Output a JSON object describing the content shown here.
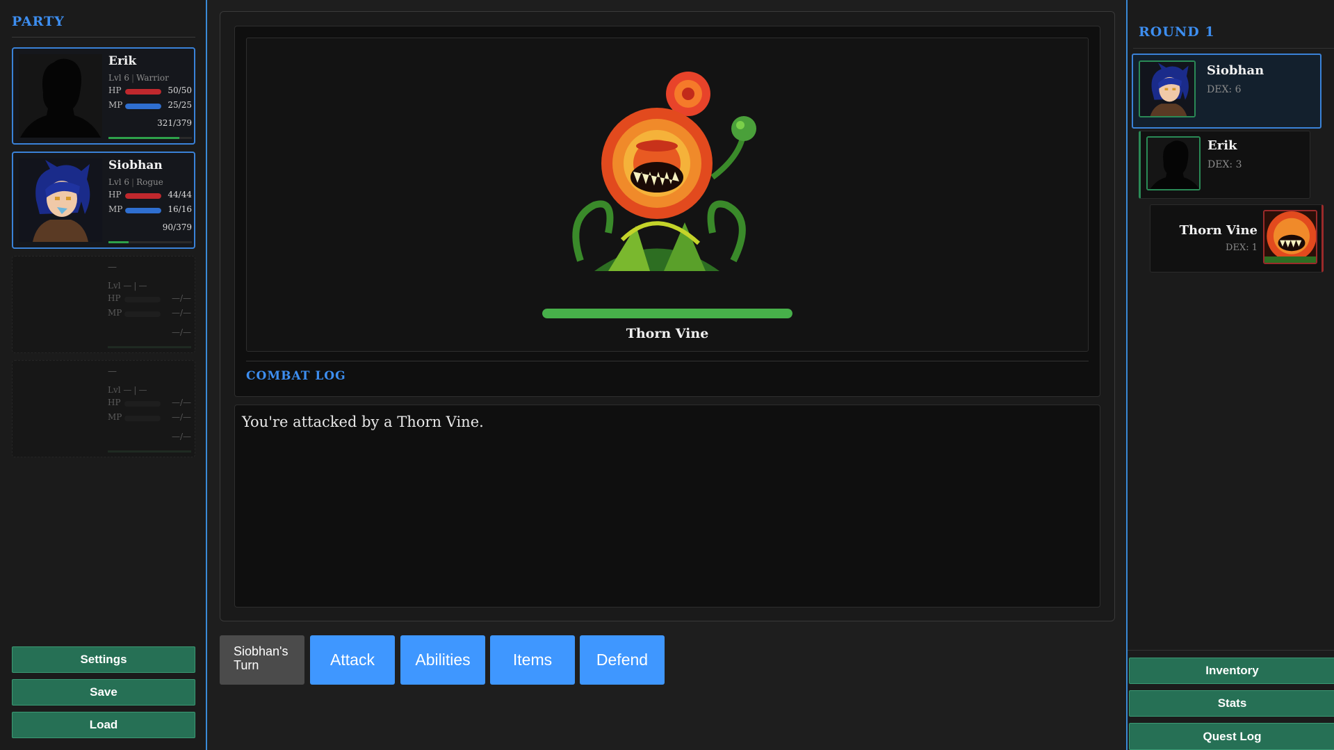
{
  "party": {
    "title": "PARTY",
    "members": [
      {
        "name": "Erik",
        "level": "Lvl 6",
        "class": "Warrior",
        "hp_label": "HP",
        "hp": "50/50",
        "hp_fraction": 1.0,
        "mp_label": "MP",
        "mp": "25/25",
        "mp_fraction": 1.0,
        "xp": "321/379",
        "xp_fraction": 0.85
      },
      {
        "name": "Siobhan",
        "level": "Lvl 6",
        "class": "Rogue",
        "hp_label": "HP",
        "hp": "44/44",
        "hp_fraction": 1.0,
        "mp_label": "MP",
        "mp": "16/16",
        "mp_fraction": 1.0,
        "xp": "90/379",
        "xp_fraction": 0.24
      },
      {
        "name": "—",
        "level": "Lvl —",
        "class": "—",
        "hp_label": "HP",
        "hp": "—/—",
        "mp_label": "MP",
        "mp": "—/—",
        "xp": "—/—"
      },
      {
        "name": "—",
        "level": "Lvl —",
        "class": "—",
        "hp_label": "HP",
        "hp": "—/—",
        "mp_label": "MP",
        "mp": "—/—",
        "xp": "—/—"
      }
    ]
  },
  "menu": {
    "settings": "Settings",
    "save": "Save",
    "load": "Load"
  },
  "enemy": {
    "name": "Thorn Vine",
    "hp_fraction": 1.0
  },
  "combat_log": {
    "title": "COMBAT LOG",
    "lines": [
      "You're attacked by a Thorn Vine."
    ]
  },
  "actions": {
    "turn": "Siobhan's Turn",
    "attack": "Attack",
    "abilities": "Abilities",
    "items": "Items",
    "defend": "Defend"
  },
  "initiative": {
    "title": "ROUND 1",
    "order": [
      {
        "name": "Siobhan",
        "dex": "DEX: 6"
      },
      {
        "name": "Erik",
        "dex": "DEX: 3"
      },
      {
        "name": "Thorn Vine",
        "dex": "DEX: 1"
      }
    ]
  },
  "right_menu": {
    "inventory": "Inventory",
    "stats": "Stats",
    "quest_log": "Quest Log"
  },
  "colors": {
    "accent": "#3d8ef0",
    "hp": "#c0282d",
    "mp": "#2f6fd0",
    "xp": "#2ea24a",
    "button_green": "#267055",
    "action_blue": "#3f97ff"
  }
}
